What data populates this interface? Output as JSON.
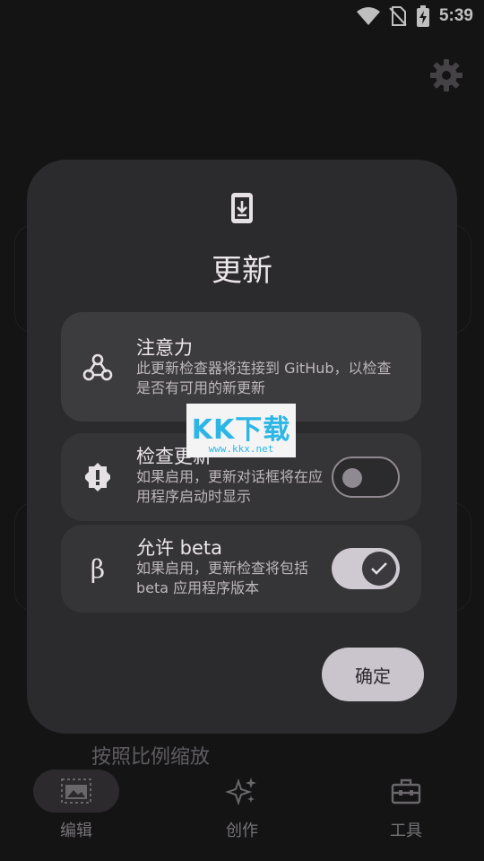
{
  "status_bar": {
    "time": "5:39"
  },
  "background": {
    "partial_text": "按照比例缩放"
  },
  "bottom_nav": {
    "items": [
      {
        "label": "编辑",
        "icon": "image-frame-icon",
        "active": true
      },
      {
        "label": "创作",
        "icon": "sparkle-icon",
        "active": false
      },
      {
        "label": "工具",
        "icon": "toolbox-icon",
        "active": false
      }
    ]
  },
  "dialog": {
    "icon": "phone-download-icon",
    "title": "更新",
    "notice": {
      "icon": "webhook-icon",
      "title": "注意力",
      "description": "此更新检查器将连接到 GitHub，以检查是否有可用的新更新"
    },
    "check_updates": {
      "icon": "alert-badge-icon",
      "title": "检查更新",
      "description": "如果启用，更新对话框将在应用程序启动时显示",
      "enabled": false
    },
    "allow_beta": {
      "icon_glyph": "β",
      "title": "允许 beta",
      "description": "如果启用，更新检查将包括 beta 应用程序版本",
      "enabled": true
    },
    "confirm_label": "确定"
  },
  "watermark": {
    "main": "KK下载",
    "sub": "www.kkx.net"
  },
  "colors": {
    "dialog_bg": "#2b2a2c",
    "switch_on": "#cfcad2",
    "watermark": "#2cb6e6"
  }
}
